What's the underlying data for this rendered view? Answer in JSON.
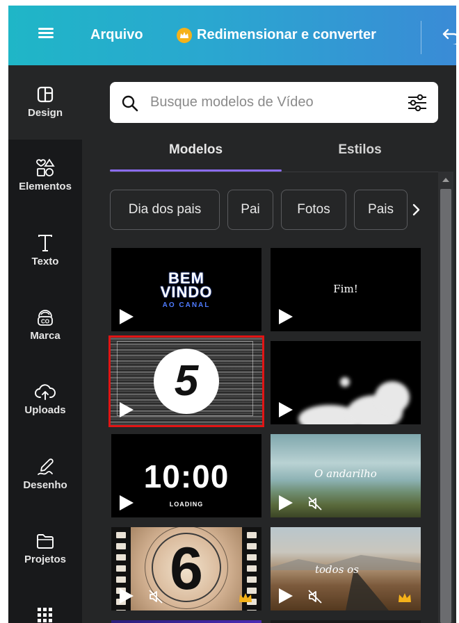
{
  "topbar": {
    "menu_icon": "hamburger-menu-icon",
    "file_label": "Arquivo",
    "resize_label": "Redimensionar e converter",
    "resize_badge_icon": "crown-icon",
    "undo_icon": "undo-icon"
  },
  "rail": {
    "items": [
      {
        "label": "Design",
        "icon": "design-layout-icon"
      },
      {
        "label": "Elementos",
        "icon": "elements-shapes-icon"
      },
      {
        "label": "Texto",
        "icon": "text-T-icon"
      },
      {
        "label": "Marca",
        "icon": "brand-icon"
      },
      {
        "label": "Uploads",
        "icon": "cloud-upload-icon"
      },
      {
        "label": "Desenho",
        "icon": "draw-pen-icon"
      },
      {
        "label": "Projetos",
        "icon": "folder-icon"
      }
    ],
    "apps_icon": "apps-grid-icon"
  },
  "search": {
    "placeholder": "Busque modelos de Vídeo",
    "search_icon": "search-icon",
    "filter_icon": "filter-sliders-icon"
  },
  "tabs": [
    {
      "label": "Modelos",
      "active": true
    },
    {
      "label": "Estilos",
      "active": false
    }
  ],
  "chips": [
    "Dia dos pais",
    "Pai",
    "Fotos",
    "Pais"
  ],
  "templates": [
    {
      "lines": [
        "BEM",
        "VINDO",
        "AO CANAL"
      ],
      "icons": [
        "play-icon"
      ]
    },
    {
      "text": "Fim!",
      "icons": [
        "play-icon"
      ]
    },
    {
      "text": "5",
      "selected": true,
      "icons": [
        "play-icon"
      ]
    },
    {
      "icons": [
        "play-icon"
      ]
    },
    {
      "text": "10:00",
      "subtext": "LOADING",
      "icons": [
        "play-icon"
      ]
    },
    {
      "text": "O andarilho",
      "icons": [
        "play-icon",
        "muted-speaker-icon"
      ]
    },
    {
      "text": "6",
      "icons": [
        "play-icon",
        "muted-speaker-icon",
        "crown-icon"
      ],
      "premium": true
    },
    {
      "text": "todos os",
      "icons": [
        "play-icon",
        "muted-speaker-icon",
        "crown-icon"
      ],
      "premium": true
    }
  ],
  "colors": {
    "accent": "#8b6cf0",
    "selection": "#e11414",
    "panel_bg": "#252627",
    "rail_bg": "#18191b",
    "crown": "#f5b21a"
  }
}
